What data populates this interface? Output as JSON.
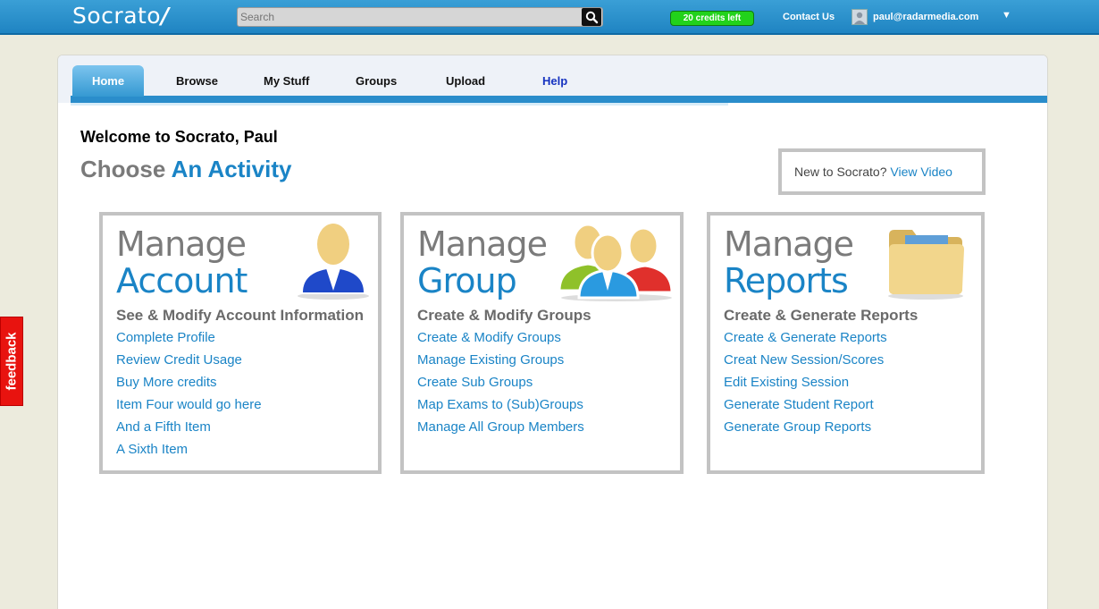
{
  "topbar": {
    "logo_text": "Socrato",
    "logo_mark": "/",
    "search_placeholder": "Search",
    "credits": "20 credits left",
    "contact": "Contact Us",
    "email": "paul@radarmedia.com"
  },
  "feedback": "feedback",
  "tabs": [
    {
      "label": "Home"
    },
    {
      "label": "Browse"
    },
    {
      "label": "My Stuff"
    },
    {
      "label": "Groups"
    },
    {
      "label": "Upload"
    },
    {
      "label": "Help"
    }
  ],
  "main": {
    "welcome": "Welcome to Socrato, Paul",
    "choose_a": "Choose",
    "choose_b": "An Activity",
    "video_text": "New to Socrato?",
    "video_link": "View Video"
  },
  "cards": [
    {
      "t1": "Manage",
      "t2": "Account",
      "subtitle": "See & Modify Account Information",
      "items": [
        "Complete Profile",
        "Review Credit Usage",
        "Buy More credits",
        "Item Four would go here",
        "And a Fifth Item",
        "A Sixth Item"
      ],
      "icon": "user-icon"
    },
    {
      "t1": "Manage",
      "t2": "Group",
      "subtitle": "Create & Modify Groups",
      "items": [
        "Create & Modify Groups",
        "Manage Existing Groups",
        "Create Sub Groups",
        "Map Exams to (Sub)Groups",
        "Manage All Group Members"
      ],
      "icon": "group-icon"
    },
    {
      "t1": "Manage",
      "t2": "Reports",
      "subtitle": "Create & Generate Reports",
      "items": [
        "Create & Generate Reports",
        "Creat New Session/Scores",
        "Edit Existing Session",
        "Generate Student Report",
        "Generate Group Reports"
      ],
      "icon": "folder-icon"
    }
  ],
  "colors": {
    "accent": "#1a84c6",
    "topbar": "#2a90cc",
    "credits": "#22d21b",
    "feedback": "#e8130f"
  }
}
